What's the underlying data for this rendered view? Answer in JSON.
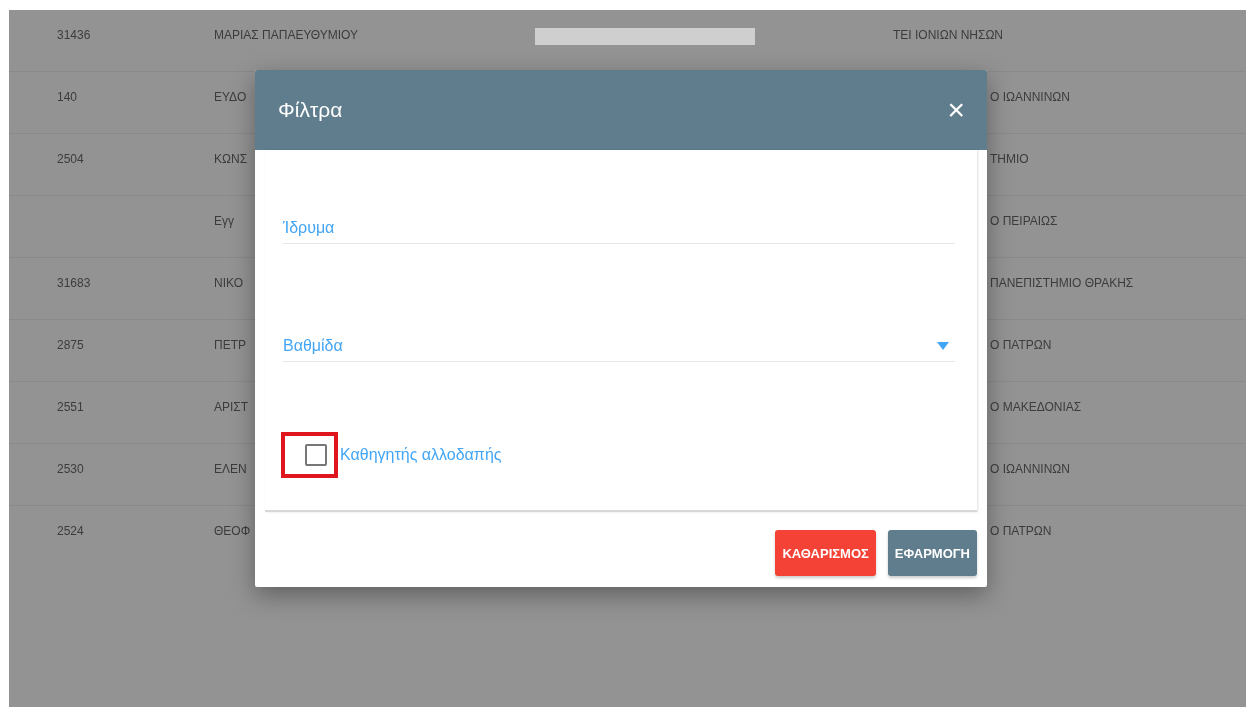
{
  "table": {
    "rows": [
      {
        "id": "31436",
        "name": "ΜΑΡΙΑΣ ΠΑΠΑΕΥΘΥΜΙΟΥ",
        "redacted": true,
        "institution": "ΤΕΙ ΙΟΝΙΩΝ ΝΗΣΩΝ"
      },
      {
        "id": "140",
        "name": "ΕΥΔΟ",
        "institution": "Ο ΙΩΑΝΝΙΝΩΝ"
      },
      {
        "id": "2504",
        "name": "ΚΩΝΣ",
        "institution": "ΤΗΜΙΟ"
      },
      {
        "name": "Εγγ",
        "institution": "Ο ΠΕΙΡΑΙΩΣ"
      },
      {
        "id": "31683",
        "name": "ΝΙΚΟ",
        "institution": "ΠΑΝΕΠΙΣΤΗΜΙΟ ΘΡΑΚΗΣ"
      },
      {
        "id": "2875",
        "name": "ΠΕΤΡ",
        "institution": "Ο ΠΑΤΡΩΝ"
      },
      {
        "id": "2551",
        "name": "ΑΡΙΣΤ",
        "institution": "Ο ΜΑΚΕΔΟΝΙΑΣ"
      },
      {
        "id": "2530",
        "name": "ΕΛΕΝ",
        "institution": "Ο ΙΩΑΝΝΙΝΩΝ"
      },
      {
        "id": "2524",
        "name": "ΘΕΟΦ",
        "institution": "Ο ΠΑΤΡΩΝ"
      }
    ]
  },
  "dialog": {
    "title": "Φίλτρα",
    "close": "×",
    "fields": [
      {
        "kind": "text",
        "placeholder": "Ίδρυμα"
      },
      {
        "kind": "select",
        "placeholder": "Βαθμίδα"
      }
    ],
    "checkbox": {
      "label": "Καθηγητής αλλοδαπής",
      "checked": false,
      "highlighted": true
    },
    "buttons": [
      {
        "label": "ΚΑΘΑΡΙΣΜΟΣ",
        "kind": "danger"
      },
      {
        "label": "ΕΦΑΡΜΟΓΗ",
        "kind": "primary"
      }
    ]
  }
}
